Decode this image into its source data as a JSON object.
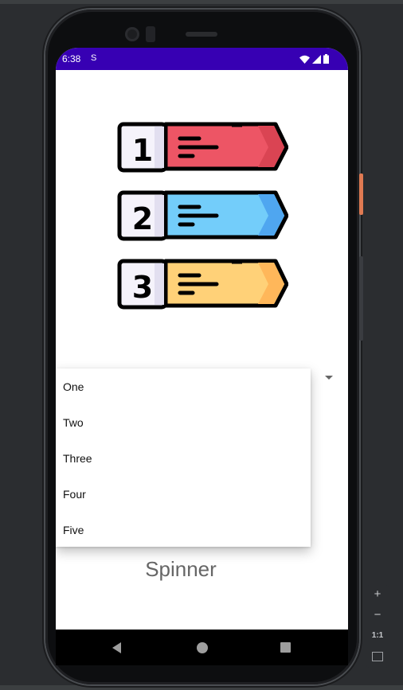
{
  "status_bar": {
    "time": "6:38",
    "app_icon": "S",
    "icons": [
      "wifi-icon",
      "signal-icon",
      "battery-icon"
    ],
    "background": "#3700b3"
  },
  "illustration": {
    "steps": [
      "1",
      "2",
      "3"
    ],
    "colors": [
      "#ed5565",
      "#73cdfa",
      "#ffd178"
    ]
  },
  "spinner": {
    "options": [
      "One",
      "Two",
      "Three",
      "Four",
      "Five"
    ],
    "label": "Spinner"
  },
  "zoom_controls": {
    "zoom_in": "+",
    "zoom_out": "−",
    "actual_size": "1:1"
  }
}
